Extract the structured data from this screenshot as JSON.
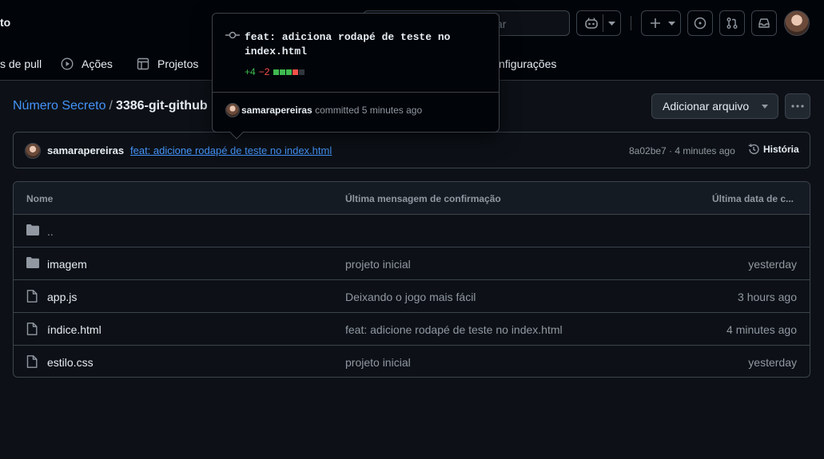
{
  "header": {
    "title_fragment": "to",
    "search_placeholder": "ar",
    "nav": [
      {
        "label": "s de pull",
        "icon": "pull-request-icon"
      },
      {
        "label": "Ações",
        "icon": "play-icon"
      },
      {
        "label": "Projetos",
        "icon": "table-icon"
      },
      {
        "label": "nfigurações",
        "icon": "gear-icon"
      }
    ]
  },
  "breadcrumb": {
    "repo": "Número Secreto",
    "separator": "/",
    "folder": "3386-git-github"
  },
  "actions": {
    "add_file": "Adicionar arquivo"
  },
  "commit": {
    "author": "samarapereiras",
    "message": "feat: adicione rodapé de teste no index.html",
    "meta": "8a02be7 · 4 minutes ago",
    "history_label": "História"
  },
  "popover": {
    "title": "feat: adiciona rodapé de teste no index.html",
    "additions": "+4",
    "deletions": "−2",
    "author": "samarapereiras",
    "committed_text": "committed 5 minutes ago",
    "diff_blocks": [
      "#3fb950",
      "#3fb950",
      "#3fb950",
      "#f85149",
      "#30363d"
    ]
  },
  "table": {
    "headers": {
      "name": "Nome",
      "message": "Última mensagem de confirmação",
      "date": "Última data de c..."
    },
    "parent": "..",
    "rows": [
      {
        "type": "folder",
        "name": "imagem",
        "message": "projeto inicial",
        "date": "yesterday"
      },
      {
        "type": "file",
        "name": "app.js",
        "message": "Deixando o jogo mais fácil",
        "date": "3 hours ago"
      },
      {
        "type": "file",
        "name": "índice.html",
        "message": "feat: adicione rodapé de teste no index.html",
        "date": "4 minutes ago"
      },
      {
        "type": "file",
        "name": "estilo.css",
        "message": "projeto inicial",
        "date": "yesterday"
      }
    ]
  },
  "colors": {
    "background": "#0d1117",
    "header_bg": "#010409",
    "link": "#4493f8",
    "muted": "#9198a1",
    "border": "#3d444d",
    "add": "#3fb950",
    "delete": "#f85149"
  }
}
